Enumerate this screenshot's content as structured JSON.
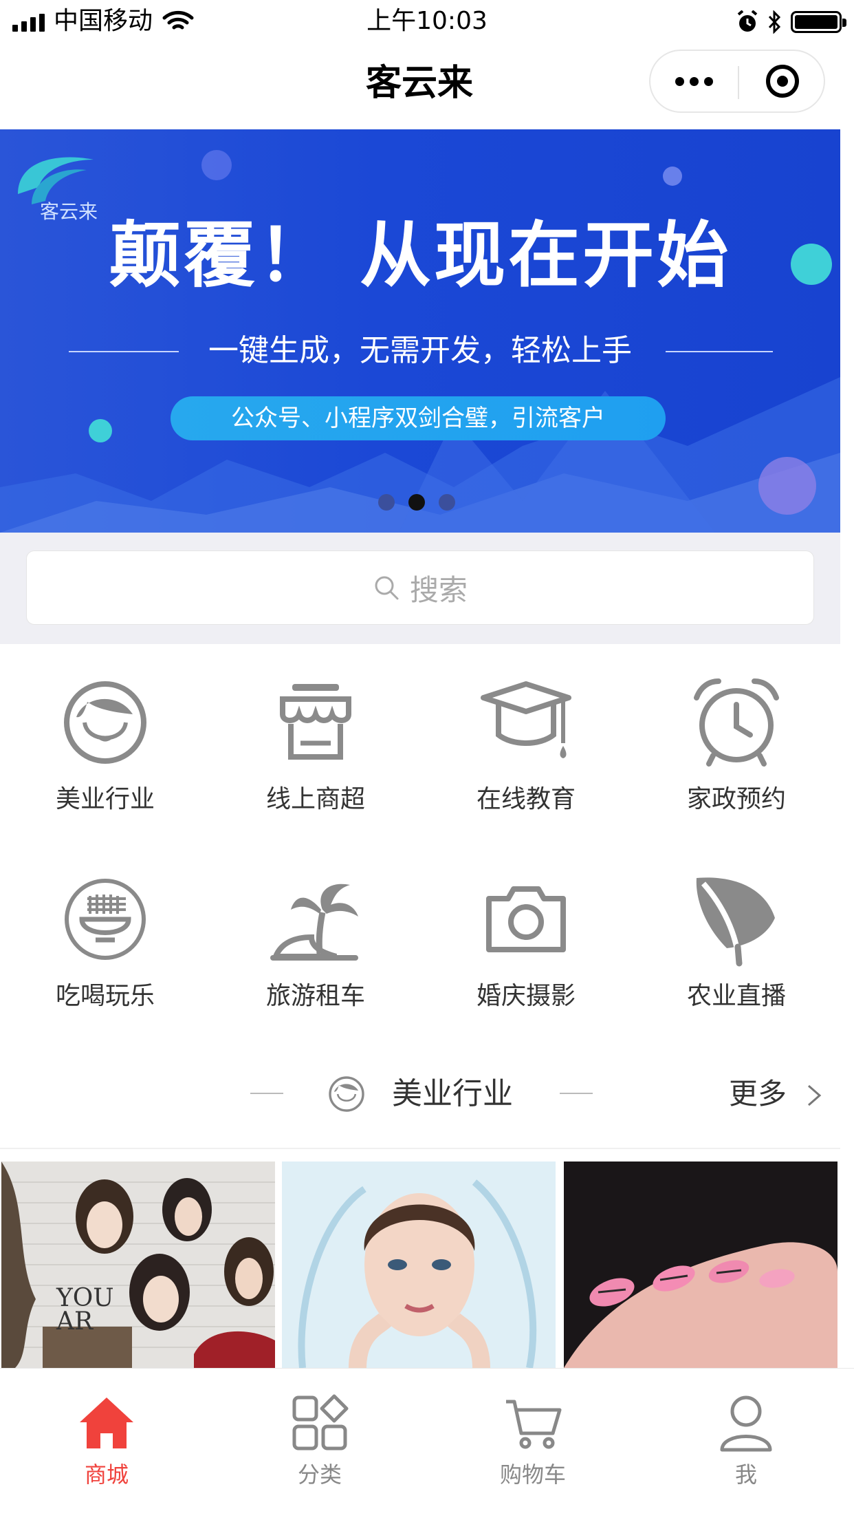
{
  "status_bar": {
    "carrier": "中国移动",
    "time": "上午10:03"
  },
  "header": {
    "title": "客云来"
  },
  "banner": {
    "logo_text": "客云来",
    "headline": "颠覆！ 从现在开始",
    "subtitle": "一键生成，无需开发，轻松上手",
    "pill": "公众号、小程序双剑合璧，引流客户",
    "slide_count": 3,
    "active_slide": 2
  },
  "search": {
    "placeholder": "搜索"
  },
  "categories": [
    {
      "label": "美业行业",
      "icon": "woman-face-icon"
    },
    {
      "label": "线上商超",
      "icon": "store-awning-icon"
    },
    {
      "label": "在线教育",
      "icon": "graduation-cap-icon"
    },
    {
      "label": "家政预约",
      "icon": "alarm-clock-icon"
    },
    {
      "label": "吃喝玩乐",
      "icon": "noodle-bowl-icon"
    },
    {
      "label": "旅游租车",
      "icon": "palm-island-icon"
    },
    {
      "label": "婚庆摄影",
      "icon": "camera-icon"
    },
    {
      "label": "农业直播",
      "icon": "leaf-icon"
    }
  ],
  "section": {
    "title": "美业行业",
    "more": "更多"
  },
  "thumbnails": [
    {
      "name": "salon-illustration",
      "text": "YOU AR"
    },
    {
      "name": "water-splash-face"
    },
    {
      "name": "pink-nails"
    }
  ],
  "tabbar": [
    {
      "label": "商城",
      "icon": "home-icon",
      "active": true
    },
    {
      "label": "分类",
      "icon": "category-grid-icon",
      "active": false
    },
    {
      "label": "购物车",
      "icon": "cart-icon",
      "active": false
    },
    {
      "label": "我",
      "icon": "user-icon",
      "active": false
    }
  ],
  "colors": {
    "accent": "#f0423c",
    "banner_blue": "#1b48d6",
    "icon_gray": "#8a8a8a"
  }
}
